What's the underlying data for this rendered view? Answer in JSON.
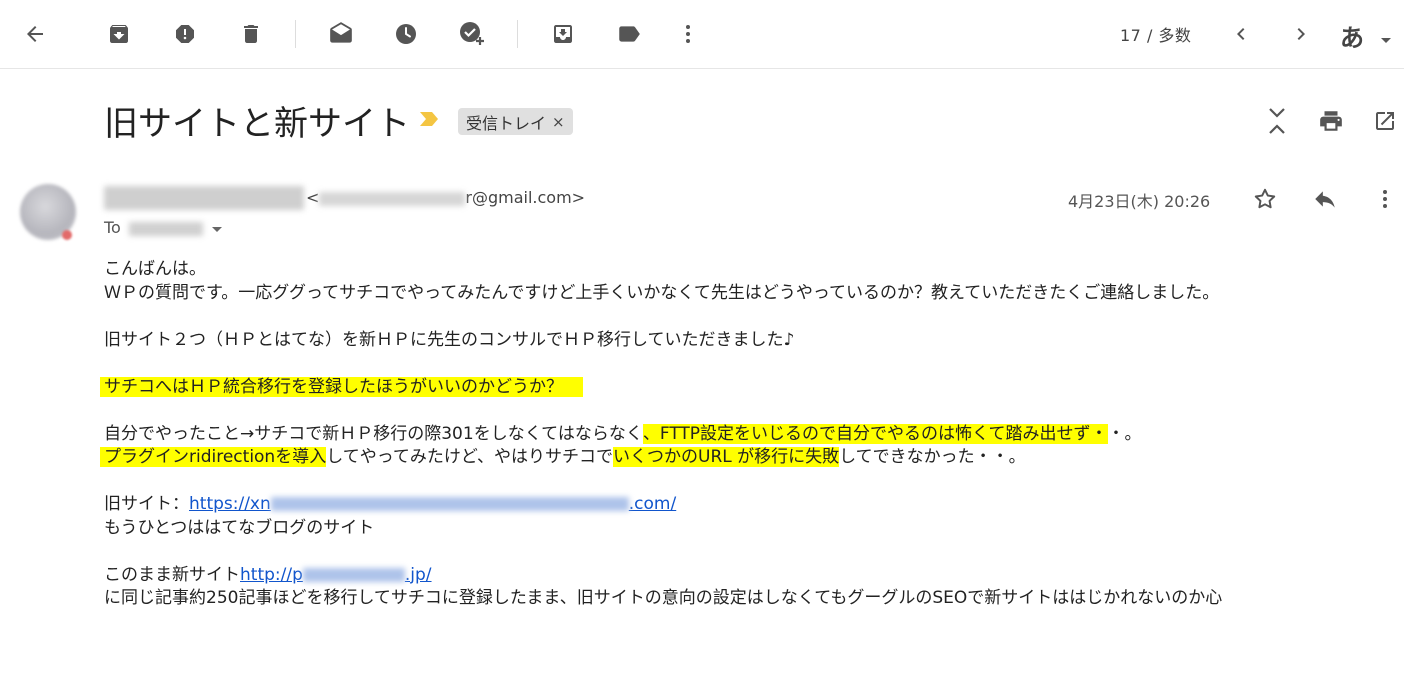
{
  "toolbar": {
    "icons": [
      "back-arrow-icon",
      "archive-icon",
      "report-spam-icon",
      "delete-icon",
      "mark-unread-icon",
      "snooze-icon",
      "add-to-tasks-icon",
      "move-to-icon",
      "label-icon",
      "more-vert-icon"
    ],
    "pager": "17 / 多数",
    "lang": "あ"
  },
  "message": {
    "subject": "旧サイトと新サイト",
    "label_chip": "受信トレイ",
    "label_close": "×",
    "sender_email_lt": "<",
    "sender_email_suffix": "r@gmail.com>",
    "to_label": "To",
    "date": "4月23日(木) 20:26"
  },
  "body": {
    "l1": "こんばんは。",
    "l2": "ＷＰの質問です。一応ググってサチコでやってみたんですけど上手くいかなくて先生はどうやっているのか？教えていただきたくご連絡しました。",
    "l3": "旧サイト２つ（ＨＰとはてな）を新ＨＰに先生のコンサルでＨＰ移行していただきました♪",
    "l4": "サチコへはＨＰ統合移行を登録したほうがいいのかどうか？",
    "l5a": "自分でやったこと→サチコで新ＨＰ移行の際301をしなくてはならなく",
    "l5b": "、FTTP設定をいじるので自分でやるのは怖くて踏み出せず・",
    "l5c": "・。",
    "l6a": "プラグインridirectionを導入",
    "l6b": "してやってみたけど、やはりサチコで",
    "l6c": "いくつかのURL が移行に失敗",
    "l6d": "してできなかった・・。",
    "l7_label": "旧サイト：",
    "l7_link_start": "https://xn",
    "l7_link_end": ".com/",
    "l8": "もうひとつははてなブログのサイト",
    "l9_label": "このまま新サイト",
    "l9_link_start": "http://p",
    "l9_link_end": ".jp/",
    "l10": "に同じ記事約250記事ほどを移行してサチコに登録したまま、旧サイトの意向の設定はしなくてもグーグルのSEOで新サイトははじかれないのか心"
  },
  "colors": {
    "highlight": "#ffff00",
    "link": "#1155cc",
    "importance": "#f4c542"
  }
}
